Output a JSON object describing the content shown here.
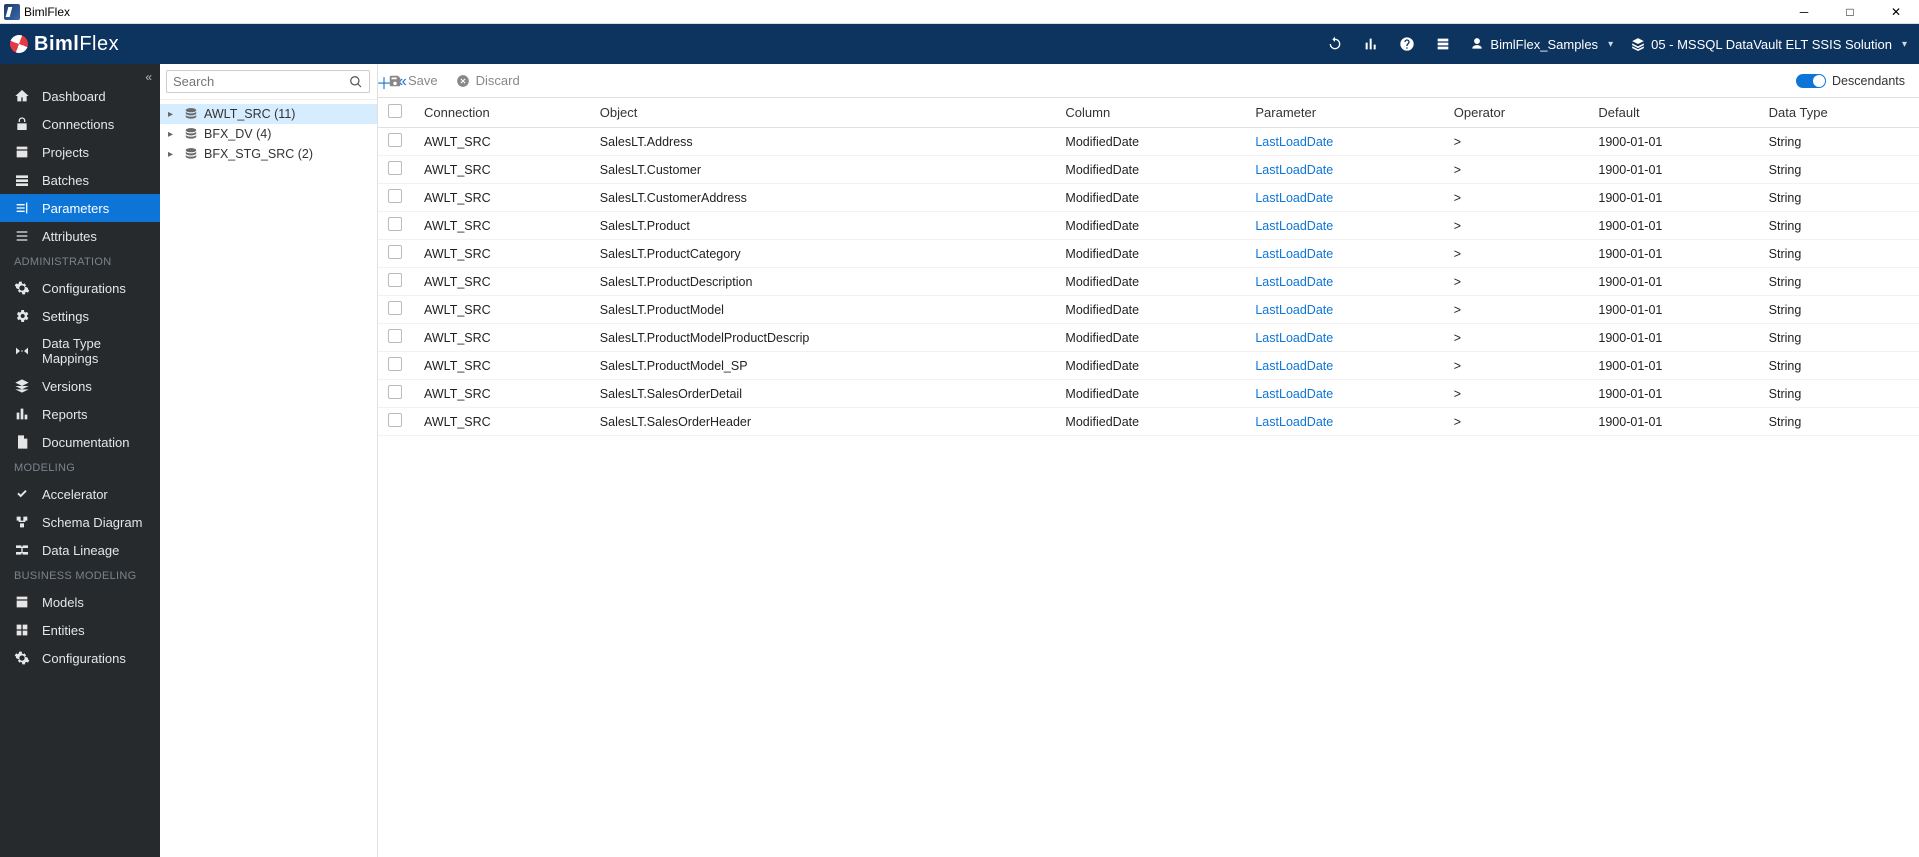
{
  "window": {
    "title": "BimlFlex"
  },
  "brand": {
    "name1": "Biml",
    "name2": "Flex"
  },
  "appbar": {
    "customer": "BimlFlex_Samples",
    "version": "05 - MSSQL DataVault ELT SSIS Solution"
  },
  "search": {
    "placeholder": "Search"
  },
  "toolbar": {
    "save": "Save",
    "discard": "Discard",
    "descendants": "Descendants"
  },
  "nav": {
    "main": [
      {
        "label": "Dashboard"
      },
      {
        "label": "Connections"
      },
      {
        "label": "Projects"
      },
      {
        "label": "Batches"
      },
      {
        "label": "Parameters"
      },
      {
        "label": "Attributes"
      }
    ],
    "admin_head": "ADMINISTRATION",
    "admin": [
      {
        "label": "Configurations"
      },
      {
        "label": "Settings"
      },
      {
        "label": "Data Type Mappings"
      },
      {
        "label": "Versions"
      },
      {
        "label": "Reports"
      },
      {
        "label": "Documentation"
      }
    ],
    "modeling_head": "MODELING",
    "modeling": [
      {
        "label": "Accelerator"
      },
      {
        "label": "Schema Diagram"
      },
      {
        "label": "Data Lineage"
      }
    ],
    "business_head": "BUSINESS MODELING",
    "business": [
      {
        "label": "Models"
      },
      {
        "label": "Entities"
      },
      {
        "label": "Configurations"
      }
    ]
  },
  "tree": [
    {
      "label": "AWLT_SRC (11)",
      "selected": true
    },
    {
      "label": "BFX_DV (4)",
      "selected": false
    },
    {
      "label": "BFX_STG_SRC (2)",
      "selected": false
    }
  ],
  "grid": {
    "headers": {
      "connection": "Connection",
      "object": "Object",
      "column": "Column",
      "parameter": "Parameter",
      "operator": "Operator",
      "default": "Default",
      "datatype": "Data Type"
    },
    "rows": [
      {
        "connection": "AWLT_SRC",
        "object": "SalesLT.Address",
        "column": "ModifiedDate",
        "parameter": "LastLoadDate",
        "operator": ">",
        "default": "1900-01-01",
        "datatype": "String"
      },
      {
        "connection": "AWLT_SRC",
        "object": "SalesLT.Customer",
        "column": "ModifiedDate",
        "parameter": "LastLoadDate",
        "operator": ">",
        "default": "1900-01-01",
        "datatype": "String"
      },
      {
        "connection": "AWLT_SRC",
        "object": "SalesLT.CustomerAddress",
        "column": "ModifiedDate",
        "parameter": "LastLoadDate",
        "operator": ">",
        "default": "1900-01-01",
        "datatype": "String"
      },
      {
        "connection": "AWLT_SRC",
        "object": "SalesLT.Product",
        "column": "ModifiedDate",
        "parameter": "LastLoadDate",
        "operator": ">",
        "default": "1900-01-01",
        "datatype": "String"
      },
      {
        "connection": "AWLT_SRC",
        "object": "SalesLT.ProductCategory",
        "column": "ModifiedDate",
        "parameter": "LastLoadDate",
        "operator": ">",
        "default": "1900-01-01",
        "datatype": "String"
      },
      {
        "connection": "AWLT_SRC",
        "object": "SalesLT.ProductDescription",
        "column": "ModifiedDate",
        "parameter": "LastLoadDate",
        "operator": ">",
        "default": "1900-01-01",
        "datatype": "String"
      },
      {
        "connection": "AWLT_SRC",
        "object": "SalesLT.ProductModel",
        "column": "ModifiedDate",
        "parameter": "LastLoadDate",
        "operator": ">",
        "default": "1900-01-01",
        "datatype": "String"
      },
      {
        "connection": "AWLT_SRC",
        "object": "SalesLT.ProductModelProductDescrip",
        "column": "ModifiedDate",
        "parameter": "LastLoadDate",
        "operator": ">",
        "default": "1900-01-01",
        "datatype": "String"
      },
      {
        "connection": "AWLT_SRC",
        "object": "SalesLT.ProductModel_SP",
        "column": "ModifiedDate",
        "parameter": "LastLoadDate",
        "operator": ">",
        "default": "1900-01-01",
        "datatype": "String"
      },
      {
        "connection": "AWLT_SRC",
        "object": "SalesLT.SalesOrderDetail",
        "column": "ModifiedDate",
        "parameter": "LastLoadDate",
        "operator": ">",
        "default": "1900-01-01",
        "datatype": "String"
      },
      {
        "connection": "AWLT_SRC",
        "object": "SalesLT.SalesOrderHeader",
        "column": "ModifiedDate",
        "parameter": "LastLoadDate",
        "operator": ">",
        "default": "1900-01-01",
        "datatype": "String"
      }
    ]
  }
}
